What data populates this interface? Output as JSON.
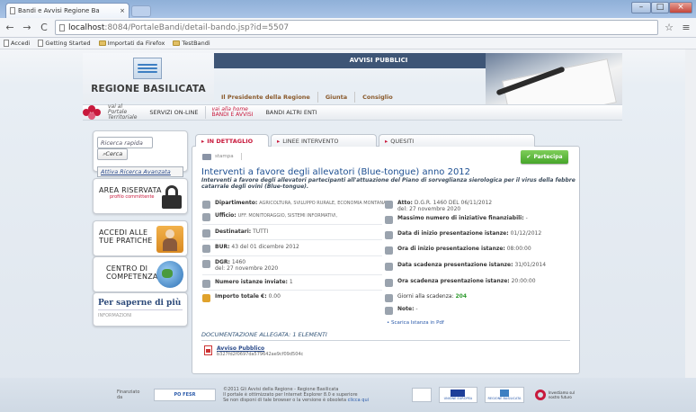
{
  "browser": {
    "tab_title": "Bandi e Avvisi Regione Ba",
    "tab_close": "×",
    "back": "←",
    "forward": "→",
    "reload": "C",
    "url_host": "localhost",
    "url_path": ":8084/PortaleBandi/detail-bando.jsp?id=5507",
    "star": "☆",
    "menu": "≡",
    "bookmarks": [
      "Accedi",
      "Getting Started",
      "Importati da Firefox",
      "TestBandi"
    ],
    "win_min": "–",
    "win_max": "□",
    "win_close": "×"
  },
  "header": {
    "region": "REGIONE BASILICATA",
    "banner": "AVVISI PUBBLICI",
    "nav": [
      "Il Presidente della Regione",
      "Giunta",
      "Consiglio"
    ],
    "portal_link_1": "vai al",
    "portal_link_2": "Portale",
    "portal_link_3": "Territoriale",
    "services": "SERVIZI ON-LINE",
    "home_link_1": "vai alla home",
    "home_link_2": "BANDI E AVVISI",
    "other": "BANDI ALTRI ENTI"
  },
  "sidebar": {
    "search_placeholder": "Ricerca rapida",
    "search_btn": "Cerca",
    "adv_search": "Attiva Ricerca Avanzata",
    "reserved": "AREA RISERVATA",
    "reserved_sub": "profilo committente",
    "access_1": "ACCEDI ALLE",
    "access_2": "TUE PRATICHE",
    "center_1": "CENTRO DI",
    "center_2": "COMPETENZA",
    "info_title": "Per saperne di più",
    "info_sub": "INFORMAZIONI"
  },
  "tabs": [
    "IN DETTAGLIO",
    "LINEE INTERVENTO",
    "QUESITI"
  ],
  "detail": {
    "print": "stampa",
    "participate": "Partecipa",
    "title": "Interventi a favore degli allevatori (Blue-tongue) anno 2012",
    "description": "Interventi a favore degli allevatori partecipanti all'attuazione del Piano di sorveglianza sierologica per il virus della febbre catarrale degli ovini (Blue-tongue).",
    "left_fields": [
      {
        "label": "Dipartimento:",
        "value": "AGRICOLTURA, SVILUPPO RURALE, ECONOMIA MONTANA"
      },
      {
        "label": "Ufficio:",
        "value": "UFF. MONITORAGGIO, SISTEMI INFORMATIVI,"
      },
      {
        "label": "Destinatari:",
        "value": "TUTTI"
      },
      {
        "label": "BUR:",
        "value": "43 del 01 dicembre 2012"
      },
      {
        "label": "DGR:",
        "value": "1460",
        "extra": "del: 27 novembre 2020"
      },
      {
        "label": "Numero istanze inviate:",
        "value": "1"
      },
      {
        "label": "Importo totale €:",
        "value": "0.00"
      }
    ],
    "right_fields": [
      {
        "label": "Atto:",
        "value": "D.G.R. 1460 DEL 06/11/2012",
        "extra": "del: 27 novembre 2020"
      },
      {
        "label": "Massimo numero di iniziative finanziabili:",
        "value": "-"
      },
      {
        "label": "Data di inizio presentazione istanze:",
        "value": "01/12/2012"
      },
      {
        "label": "Ora di inizio presentazione istanze:",
        "value": "08:00:00"
      },
      {
        "label": "Data scadenza presentazione istanze:",
        "value": "31/01/2014"
      },
      {
        "label": "Ora scadenza presentazione istanze:",
        "value": "20:00:00"
      },
      {
        "label": "Giorni alla scadenza:",
        "value": "204"
      },
      {
        "label": "Note:",
        "value": "-"
      }
    ],
    "download": "• Scarica Istanza in Pdf",
    "docs_header": "DOCUMENTAZIONE ALLEGATA: 1 ELEMENTI",
    "doc_name": "Avviso Pubblico",
    "doc_hash": "b327fd2f0697da579642ae9cf09d504c"
  },
  "footer": {
    "funded": "Finanziato da",
    "text_1": "©2011 Gli Avvisi della Regione - Regione Basilicata",
    "text_2": "Il portale è ottimizzato per Internet Explorer 8.0 e superiore",
    "text_3": "Se non disponi di tale browser o la versione è obsoleta",
    "text_link": "clicca qui",
    "logo_right_1": "UNIONE EUROPEA",
    "logo_right_2": "REGIONE BASILICATA",
    "logo_right_3": "Investiamo sul nostro futuro"
  }
}
